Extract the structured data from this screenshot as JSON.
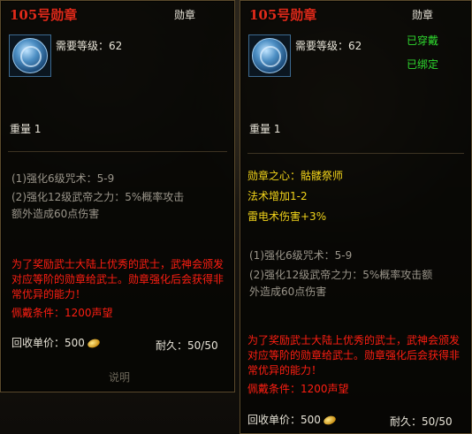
{
  "panels": [
    {
      "title": "105号勋章",
      "type": "勋章",
      "level_req": "需要等级：62",
      "worn": "",
      "bound": "",
      "weight": "重量  1",
      "stats": [
        "(1)强化6级咒术：5-9",
        "(2)强化12级武帝之力：5%概率攻击额外造成60点伤害"
      ],
      "extra": [],
      "desc": "为了奖励武士大陆上优秀的武士，武神会颁发对应等阶的勋章给武士。勋章强化后会获得非常优异的能力！",
      "wear_cond": "佩戴条件：1200声望",
      "price_label": "回收单价：500",
      "durability": "耐久：50/50",
      "explain": "说明"
    },
    {
      "title": "105号勋章",
      "type": "勋章",
      "level_req": "需要等级：62",
      "worn": "已穿戴",
      "bound": "已绑定",
      "weight": "重量  1",
      "extra": [
        "勋章之心：骷髅祭师",
        "法术增加1-2",
        "雷电术伤害+3%"
      ],
      "stats": [
        "(1)强化6级咒术：5-9",
        "(2)强化12级武帝之力：5%概率攻击额外造成60点伤害"
      ],
      "desc": "为了奖励武士大陆上优秀的武士，武神会颁发对应等阶的勋章给武士。勋章强化后会获得非常优异的能力！",
      "wear_cond": "佩戴条件：1200声望",
      "price_label": "回收单价：500",
      "durability": "耐久：50/50"
    }
  ],
  "colors": {
    "title": "#e02a1a",
    "green": "#2fd92f",
    "gold": "#f2d41a",
    "red": "#ff1e12"
  }
}
